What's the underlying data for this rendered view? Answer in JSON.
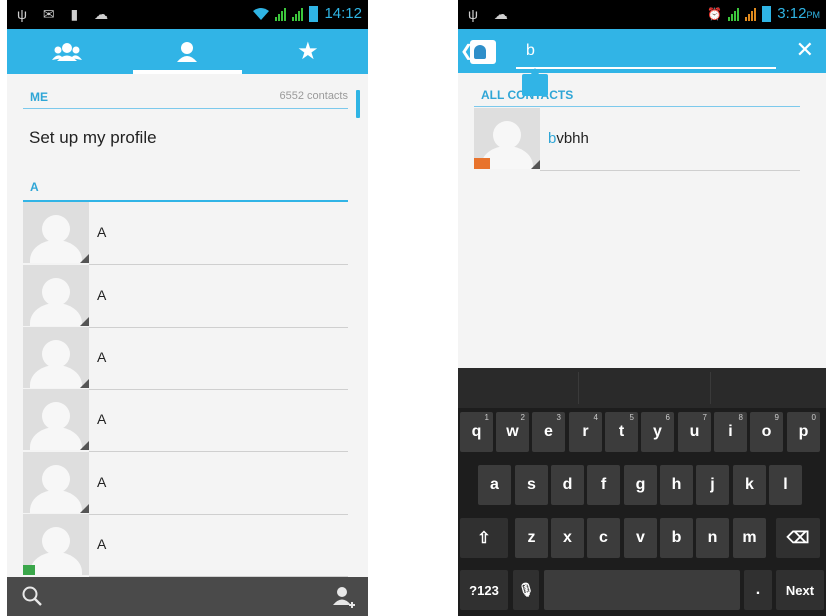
{
  "left": {
    "status": {
      "time": "14:12"
    },
    "tabs": [
      {
        "icon": "groups-icon",
        "active": false
      },
      {
        "icon": "person-icon",
        "active": true
      },
      {
        "icon": "star-icon",
        "active": false
      }
    ],
    "me_label": "ME",
    "contact_count": "6552 contacts",
    "profile_text": "Set up my profile",
    "section_letter": "A",
    "contacts": [
      "A",
      "A",
      "A",
      "A",
      "A",
      "A"
    ]
  },
  "right": {
    "status": {
      "time": "3:12",
      "ampm": "PM"
    },
    "search": {
      "query": "b"
    },
    "all_contacts_label": "ALL CONTACTS",
    "result": {
      "highlight": "b",
      "rest": "vbhh"
    },
    "keyboard": {
      "row1": [
        {
          "k": "q",
          "h": "1"
        },
        {
          "k": "w",
          "h": "2"
        },
        {
          "k": "e",
          "h": "3"
        },
        {
          "k": "r",
          "h": "4"
        },
        {
          "k": "t",
          "h": "5"
        },
        {
          "k": "y",
          "h": "6"
        },
        {
          "k": "u",
          "h": "7"
        },
        {
          "k": "i",
          "h": "8"
        },
        {
          "k": "o",
          "h": "9"
        },
        {
          "k": "p",
          "h": "0"
        }
      ],
      "row2": [
        "a",
        "s",
        "d",
        "f",
        "g",
        "h",
        "j",
        "k",
        "l"
      ],
      "row3": [
        "z",
        "x",
        "c",
        "v",
        "b",
        "n",
        "m"
      ],
      "sym_label": "?123",
      "period_label": ".",
      "next_label": "Next"
    }
  }
}
